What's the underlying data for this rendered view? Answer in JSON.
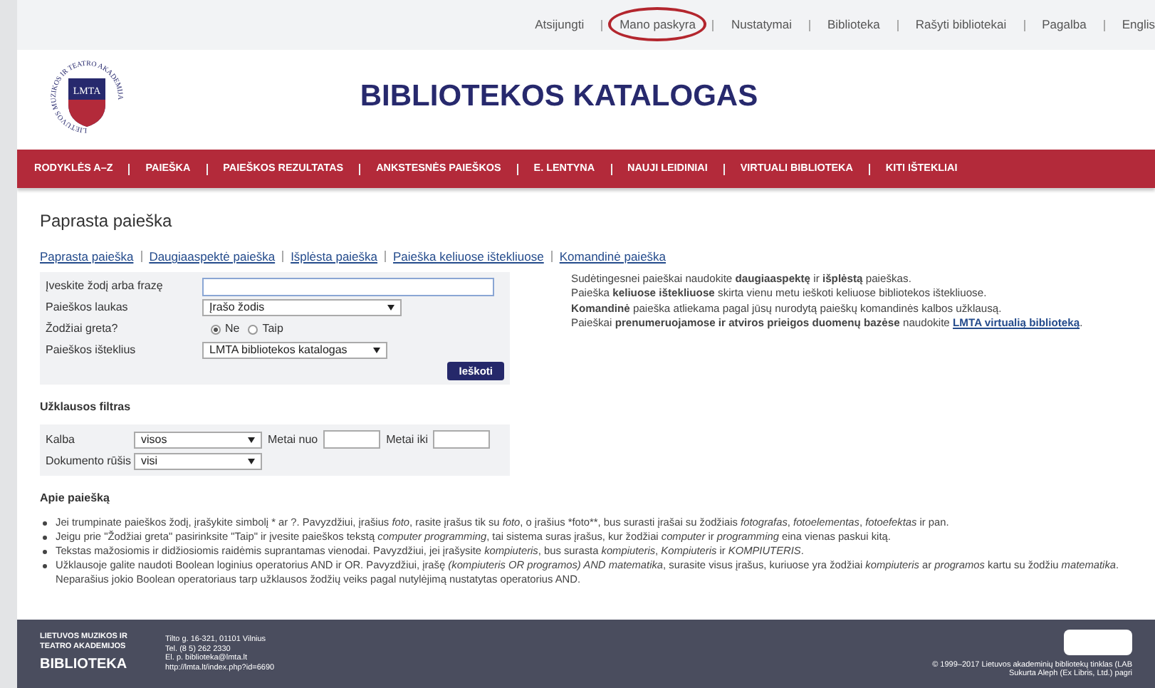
{
  "top_links": [
    {
      "label": "Atsijungti",
      "circled": false
    },
    {
      "label": "Mano paskyra",
      "circled": true
    },
    {
      "label": "Nustatymai",
      "circled": false
    },
    {
      "label": "Biblioteka",
      "circled": false
    },
    {
      "label": "Rašyti bibliotekai",
      "circled": false
    },
    {
      "label": "Pagalba",
      "circled": false
    },
    {
      "label": "Englis",
      "circled": false
    }
  ],
  "logo": {
    "text": "LMTA",
    "ring_text": "LIETUVOS MUZIKOS IR TEATRO AKADEMIJA"
  },
  "header_title": "BIBLIOTEKOS KATALOGAS",
  "nav": [
    "RODYKLĖS A–Z",
    "PAIEŠKA",
    "PAIEŠKOS REZULTATAS",
    "ANKSTESNĖS PAIEŠKOS",
    "E. LENTYNA",
    "NAUJI LEIDINIAI",
    "VIRTUALI BIBLIOTEKA",
    "KITI IŠTEKLIAI"
  ],
  "page_title": "Paprasta paieška",
  "search_types": [
    "Paprasta paieška",
    "Daugiaaspektė paieška",
    "Išplėsta paieška",
    "Paieška keliuose ištekliuose",
    "Komandinė paieška"
  ],
  "form": {
    "rows": [
      {
        "kind": "text",
        "label": "Įveskite žodį arba frazę",
        "value": ""
      },
      {
        "kind": "select",
        "label": "Paieškos laukas",
        "value": "Įrašo žodis"
      },
      {
        "kind": "radio",
        "label": "Žodžiai greta?",
        "options": [
          {
            "label": "Ne",
            "selected": true
          },
          {
            "label": "Taip",
            "selected": false
          }
        ]
      },
      {
        "kind": "select",
        "label": "Paieškos išteklius",
        "value": "LMTA bibliotekos katalogas"
      }
    ],
    "submit": "Ieškoti"
  },
  "info_lines": [
    {
      "text": "Sudėtingesnei paieškai naudokite **daugiaaspektę** ir **išplėstą** paieškas."
    },
    {
      "text": "Paieška **keliuose ištekliuose** skirta vienu metu ieškoti keliuose bibliotekos ištekliuose."
    },
    {
      "text": "**Komandinė** paieška atliekama pagal jūsų nurodytą paieškų komandinės kalbos užklausą."
    },
    {
      "text": "Paieškai **prenumeruojamose ir atviros prieigos duomenų bazėse** naudokite",
      "link": "LMTA virtualią biblioteką",
      "after": "."
    }
  ],
  "filter": {
    "title": "Užklausos filtras",
    "language_label": "Kalba",
    "language_value": "visos",
    "year_from_label": "Metai nuo",
    "year_to_label": "Metai iki",
    "doctype_label": "Dokumento rūšis",
    "doctype_value": "visi"
  },
  "about": {
    "title": "Apie paiešką",
    "items": [
      "Jei trumpinate paieškos žodį, įrašykite simbolį * ar ?. Pavyzdžiui, įrašius *foto*, rasite įrašus tik su *foto*, o įrašius *foto**, bus surasti įrašai su žodžiais *fotografas*, *fotoelementas*, *fotoefektas* ir pan.",
      "Jeigu prie \"Žodžiai greta\" pasirinksite \"Taip\" ir įvesite paieškos tekstą *computer programming*, tai sistema suras įrašus, kur žodžiai *computer* ir *programming* eina vienas paskui kitą.",
      "Tekstas mažosiomis ir didžiosiomis raidėmis suprantamas vienodai. Pavyzdžiui, jei įrašysite *kompiuteris*, bus surasta *kompiuteris*, *Kompiuteris* ir *KOMPIUTERIS*.",
      "Užklausoje galite naudoti Boolean loginius operatorius AND ir OR. Pavyzdžiui, įrašę *(kompiuteris OR programos) AND matematika*, surasite visus įrašus, kuriuose yra žodžiai *kompiuteris* ar *programos* kartu su žodžiu *matematika*. Neparašius jokio Boolean operatoriaus tarp užklausos žodžių veiks pagal nutylėjimą nustatytas operatorius AND."
    ]
  },
  "footer": {
    "org_lines": [
      "LIETUVOS MUZIKOS IR",
      "TEATRO AKADEMIJOS"
    ],
    "org_title": "BIBLIOTEKA",
    "address_lines": [
      "Tilto g. 16-321, 01101 Vilnius",
      "Tel. (8 5) 262 2330",
      "El. p. biblioteka@lmta.lt",
      "http://lmta.lt/index.php?id=6690"
    ],
    "copyright": "© 1999–2017 Lietuvos akademinių bibliotekų tinklas (LAB",
    "credit": "Sukurta Aleph (Ex Libris, Ltd.) pagri"
  }
}
